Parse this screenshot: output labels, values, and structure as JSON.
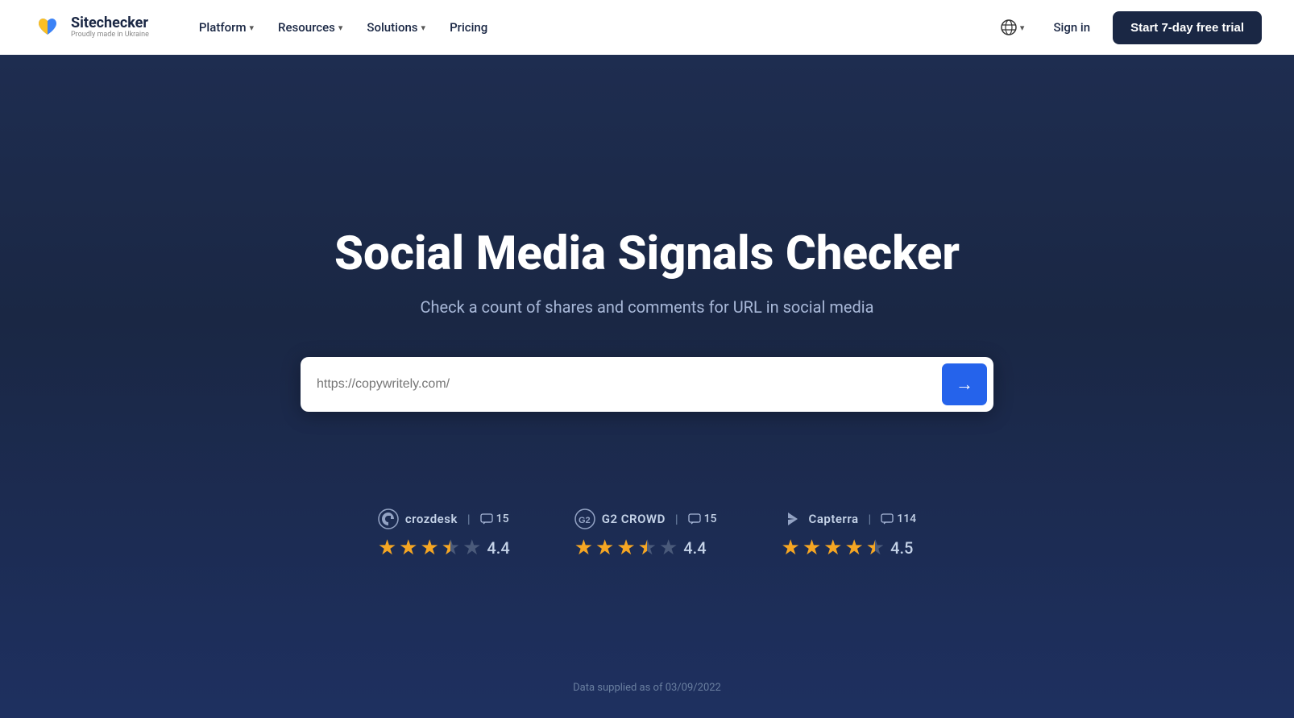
{
  "navbar": {
    "logo_name": "Sitechecker",
    "logo_tagline": "Proudly made in Ukraine",
    "nav_items": [
      {
        "label": "Platform",
        "has_dropdown": true
      },
      {
        "label": "Resources",
        "has_dropdown": true
      },
      {
        "label": "Solutions",
        "has_dropdown": true
      },
      {
        "label": "Pricing",
        "has_dropdown": false
      }
    ],
    "signin_label": "Sign in",
    "trial_label": "Start 7-day free trial"
  },
  "hero": {
    "title": "Social Media Signals Checker",
    "subtitle": "Check a count of shares and comments for URL in social media",
    "search_placeholder": "https://copywritely.com/"
  },
  "ratings": [
    {
      "platform": "crozdesk",
      "review_count": "15",
      "stars": [
        1,
        1,
        1,
        0.5,
        0
      ],
      "score": "4.4"
    },
    {
      "platform": "G2 CROWD",
      "review_count": "15",
      "stars": [
        1,
        1,
        1,
        0.5,
        0
      ],
      "score": "4.4"
    },
    {
      "platform": "Capterra",
      "review_count": "114",
      "stars": [
        1,
        1,
        1,
        1,
        0.5
      ],
      "score": "4.5"
    }
  ],
  "data_note": "Data supplied as of 03/09/2022"
}
